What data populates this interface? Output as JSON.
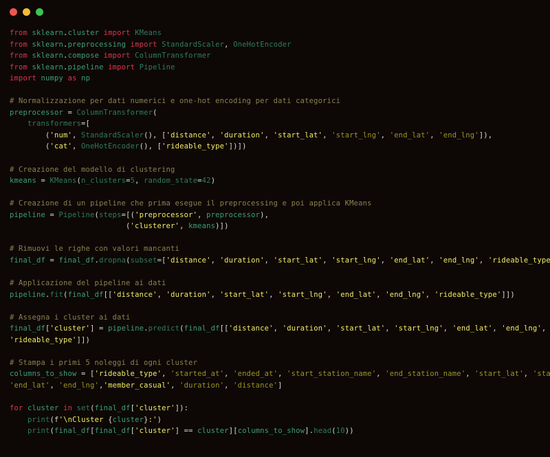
{
  "window": {
    "name": "code-editor-window",
    "background": "#0d0806",
    "traffic_lights": [
      {
        "name": "close-button",
        "color": "#f0564f",
        "label": "close"
      },
      {
        "name": "minimize-button",
        "color": "#f2bb35",
        "label": "minimize"
      },
      {
        "name": "maximize-button",
        "color": "#3ec44f",
        "label": "maximize"
      }
    ]
  },
  "theme": {
    "keyword": "#e0344d",
    "identifier": "#3d9e7a",
    "function": "#2f7a62",
    "string": "#e8e05a",
    "string_dim": "#9a9326",
    "comment": "#8a8050",
    "plain": "#dcdcd0",
    "number": "#2f7a62"
  },
  "code": {
    "language": "python",
    "lines": [
      "from sklearn.cluster import KMeans",
      "from sklearn.preprocessing import StandardScaler, OneHotEncoder",
      "from sklearn.compose import ColumnTransformer",
      "from sklearn.pipeline import Pipeline",
      "import numpy as np",
      "",
      "# Normalizzazione per dati numerici e one-hot encoding per dati categorici",
      "preprocessor = ColumnTransformer(",
      "    transformers=[",
      "        ('num', StandardScaler(), ['distance', 'duration', 'start_lat', 'start_lng', 'end_lat', 'end_lng']),",
      "        ('cat', OneHotEncoder(), ['rideable_type'])])",
      "",
      "# Creazione del modello di clustering",
      "kmeans = KMeans(n_clusters=5, random_state=42)",
      "",
      "# Creazione di un pipeline che prima esegue il preprocessing e poi applica KMeans",
      "pipeline = Pipeline(steps=[('preprocessor', preprocessor),",
      "                          ('clusterer', kmeans)])",
      "",
      "# Rimuovi le righe con valori mancanti",
      "final_df = final_df.dropna(subset=['distance', 'duration', 'start_lat', 'start_lng', 'end_lat', 'end_lng', 'rideable_type'])",
      "",
      "# Applicazione del pipeline ai dati",
      "pipeline.fit(final_df[['distance', 'duration', 'start_lat', 'start_lng', 'end_lat', 'end_lng', 'rideable_type']])",
      "",
      "# Assegna i cluster ai dati",
      "final_df['cluster'] = pipeline.predict(final_df[['distance', 'duration', 'start_lat', 'start_lng', 'end_lat', 'end_lng', 'rideable_type']])",
      "",
      "# Stampa i primi 5 noleggi di ogni cluster",
      "columns_to_show = ['rideable_type', 'started_at', 'ended_at', 'start_station_name', 'end_station_name', 'start_lat', 'start_lng', 'end_lat', 'end_lng','member_casual', 'duration', 'distance']",
      "",
      "for cluster in set(final_df['cluster']):",
      "    print(f'\\nCluster {cluster}:')",
      "    print(final_df[final_df['cluster'] == cluster][columns_to_show].head(10))"
    ],
    "segments": [
      [
        [
          "kw",
          "from"
        ],
        [
          "pl",
          " "
        ],
        [
          "name",
          "sklearn"
        ],
        [
          "pl",
          "."
        ],
        [
          "name",
          "cluster"
        ],
        [
          "pl",
          " "
        ],
        [
          "kw",
          "import"
        ],
        [
          "pl",
          " "
        ],
        [
          "cls",
          "KMeans"
        ]
      ],
      [
        [
          "kw",
          "from"
        ],
        [
          "pl",
          " "
        ],
        [
          "name",
          "sklearn"
        ],
        [
          "pl",
          "."
        ],
        [
          "name",
          "preprocessing"
        ],
        [
          "pl",
          " "
        ],
        [
          "kw",
          "import"
        ],
        [
          "pl",
          " "
        ],
        [
          "cls",
          "StandardScaler"
        ],
        [
          "pl",
          ", "
        ],
        [
          "cls",
          "OneHotEncoder"
        ]
      ],
      [
        [
          "kw",
          "from"
        ],
        [
          "pl",
          " "
        ],
        [
          "name",
          "sklearn"
        ],
        [
          "pl",
          "."
        ],
        [
          "name",
          "compose"
        ],
        [
          "pl",
          " "
        ],
        [
          "kw",
          "import"
        ],
        [
          "pl",
          " "
        ],
        [
          "cls",
          "ColumnTransformer"
        ]
      ],
      [
        [
          "kw",
          "from"
        ],
        [
          "pl",
          " "
        ],
        [
          "name",
          "sklearn"
        ],
        [
          "pl",
          "."
        ],
        [
          "name",
          "pipeline"
        ],
        [
          "pl",
          " "
        ],
        [
          "kw",
          "import"
        ],
        [
          "pl",
          " "
        ],
        [
          "cls",
          "Pipeline"
        ]
      ],
      [
        [
          "kw",
          "import"
        ],
        [
          "pl",
          " "
        ],
        [
          "name",
          "numpy"
        ],
        [
          "pl",
          " "
        ],
        [
          "kw",
          "as"
        ],
        [
          "pl",
          " "
        ],
        [
          "name",
          "np"
        ]
      ],
      [],
      [
        [
          "com",
          "# Normalizzazione per dati numerici e one-hot encoding per dati categorici"
        ]
      ],
      [
        [
          "name",
          "preprocessor"
        ],
        [
          "pl",
          " = "
        ],
        [
          "fn",
          "ColumnTransformer"
        ],
        [
          "pl",
          "("
        ]
      ],
      [
        [
          "pl",
          "    "
        ],
        [
          "param",
          "transformers"
        ],
        [
          "pl",
          "=["
        ]
      ],
      [
        [
          "pl",
          "        ("
        ],
        [
          "bright",
          "'num'"
        ],
        [
          "pl",
          ", "
        ],
        [
          "fn",
          "StandardScaler"
        ],
        [
          "pl",
          "(), ["
        ],
        [
          "bright",
          "'distance'"
        ],
        [
          "pl",
          ", "
        ],
        [
          "bright",
          "'duration'"
        ],
        [
          "pl",
          ", "
        ],
        [
          "bright",
          "'start_lat'"
        ],
        [
          "pl",
          ", "
        ],
        [
          "strd",
          "'start_lng'"
        ],
        [
          "pl",
          ", "
        ],
        [
          "strd",
          "'end_lat'"
        ],
        [
          "pl",
          ", "
        ],
        [
          "strd",
          "'end_lng'"
        ],
        [
          "pl",
          "]),"
        ]
      ],
      [
        [
          "pl",
          "        ("
        ],
        [
          "bright",
          "'cat'"
        ],
        [
          "pl",
          ", "
        ],
        [
          "fn",
          "OneHotEncoder"
        ],
        [
          "pl",
          "(), ["
        ],
        [
          "bright",
          "'rideable_type'"
        ],
        [
          "pl",
          "])])"
        ]
      ],
      [],
      [
        [
          "com",
          "# Creazione del modello di clustering"
        ]
      ],
      [
        [
          "name",
          "kmeans"
        ],
        [
          "pl",
          " = "
        ],
        [
          "fn",
          "KMeans"
        ],
        [
          "pl",
          "("
        ],
        [
          "param",
          "n_clusters"
        ],
        [
          "pl",
          "="
        ],
        [
          "num",
          "5"
        ],
        [
          "pl",
          ", "
        ],
        [
          "param",
          "random_state"
        ],
        [
          "pl",
          "="
        ],
        [
          "num",
          "42"
        ],
        [
          "pl",
          ")"
        ]
      ],
      [],
      [
        [
          "com",
          "# Creazione di un pipeline che prima esegue il preprocessing e poi applica KMeans"
        ]
      ],
      [
        [
          "name",
          "pipeline"
        ],
        [
          "pl",
          " = "
        ],
        [
          "fn",
          "Pipeline"
        ],
        [
          "pl",
          "("
        ],
        [
          "param",
          "steps"
        ],
        [
          "pl",
          "=[("
        ],
        [
          "bright",
          "'preprocessor'"
        ],
        [
          "pl",
          ", "
        ],
        [
          "name",
          "preprocessor"
        ],
        [
          "pl",
          "),"
        ]
      ],
      [
        [
          "pl",
          "                          ("
        ],
        [
          "bright",
          "'clusterer'"
        ],
        [
          "pl",
          ", "
        ],
        [
          "name",
          "kmeans"
        ],
        [
          "pl",
          ")])"
        ]
      ],
      [],
      [
        [
          "com",
          "# Rimuovi le righe con valori mancanti"
        ]
      ],
      [
        [
          "name",
          "final_df"
        ],
        [
          "pl",
          " = "
        ],
        [
          "name",
          "final_df"
        ],
        [
          "pl",
          "."
        ],
        [
          "fn",
          "dropna"
        ],
        [
          "pl",
          "("
        ],
        [
          "param",
          "subset"
        ],
        [
          "pl",
          "=["
        ],
        [
          "bright",
          "'distance'"
        ],
        [
          "pl",
          ", "
        ],
        [
          "bright",
          "'duration'"
        ],
        [
          "pl",
          ", "
        ],
        [
          "bright",
          "'start_lat'"
        ],
        [
          "pl",
          ", "
        ],
        [
          "bright",
          "'start_lng'"
        ],
        [
          "pl",
          ", "
        ],
        [
          "bright",
          "'end_lat'"
        ],
        [
          "pl",
          ", "
        ],
        [
          "bright",
          "'end_lng'"
        ],
        [
          "pl",
          ", "
        ],
        [
          "bright",
          "'rideable_type'"
        ],
        [
          "pl",
          "])"
        ]
      ],
      [],
      [
        [
          "com",
          "# Applicazione del pipeline ai dati"
        ]
      ],
      [
        [
          "name",
          "pipeline"
        ],
        [
          "pl",
          "."
        ],
        [
          "fn",
          "fit"
        ],
        [
          "pl",
          "("
        ],
        [
          "name",
          "final_df"
        ],
        [
          "pl",
          "[["
        ],
        [
          "bright",
          "'distance'"
        ],
        [
          "pl",
          ", "
        ],
        [
          "bright",
          "'duration'"
        ],
        [
          "pl",
          ", "
        ],
        [
          "bright",
          "'start_lat'"
        ],
        [
          "pl",
          ", "
        ],
        [
          "bright",
          "'start_lng'"
        ],
        [
          "pl",
          ", "
        ],
        [
          "bright",
          "'end_lat'"
        ],
        [
          "pl",
          ", "
        ],
        [
          "bright",
          "'end_lng'"
        ],
        [
          "pl",
          ", "
        ],
        [
          "bright",
          "'rideable_type'"
        ],
        [
          "pl",
          "]])"
        ]
      ],
      [],
      [
        [
          "com",
          "# Assegna i cluster ai dati"
        ]
      ],
      [
        [
          "name",
          "final_df"
        ],
        [
          "pl",
          "["
        ],
        [
          "bright",
          "'cluster'"
        ],
        [
          "pl",
          "] = "
        ],
        [
          "name",
          "pipeline"
        ],
        [
          "pl",
          "."
        ],
        [
          "fn",
          "predict"
        ],
        [
          "pl",
          "("
        ],
        [
          "name",
          "final_df"
        ],
        [
          "pl",
          "[["
        ],
        [
          "bright",
          "'distance'"
        ],
        [
          "pl",
          ", "
        ],
        [
          "bright",
          "'duration'"
        ],
        [
          "pl",
          ", "
        ],
        [
          "bright",
          "'start_lat'"
        ],
        [
          "pl",
          ", "
        ],
        [
          "bright",
          "'start_lng'"
        ],
        [
          "pl",
          ", "
        ],
        [
          "bright",
          "'end_lat'"
        ],
        [
          "pl",
          ", "
        ],
        [
          "bright",
          "'end_lng'"
        ],
        [
          "pl",
          ","
        ]
      ],
      [
        [
          "bright",
          "'rideable_type'"
        ],
        [
          "pl",
          "]])"
        ]
      ],
      [],
      [
        [
          "com",
          "# Stampa i primi 5 noleggi di ogni cluster"
        ]
      ],
      [
        [
          "name",
          "columns_to_show"
        ],
        [
          "pl",
          " = ["
        ],
        [
          "bright",
          "'rideable_type'"
        ],
        [
          "pl",
          ", "
        ],
        [
          "strd",
          "'started_at'"
        ],
        [
          "pl",
          ", "
        ],
        [
          "strd",
          "'ended_at'"
        ],
        [
          "pl",
          ", "
        ],
        [
          "strd",
          "'start_station_name'"
        ],
        [
          "pl",
          ", "
        ],
        [
          "strd",
          "'end_station_name'"
        ],
        [
          "pl",
          ", "
        ],
        [
          "strd",
          "'start_lat'"
        ],
        [
          "pl",
          ", "
        ],
        [
          "strd",
          "'start_lng'"
        ],
        [
          "pl",
          ","
        ]
      ],
      [
        [
          "strd",
          "'end_lat'"
        ],
        [
          "pl",
          ", "
        ],
        [
          "strd",
          "'end_lng'"
        ],
        [
          "pl",
          ","
        ],
        [
          "bright",
          "'member_casual'"
        ],
        [
          "pl",
          ", "
        ],
        [
          "strd",
          "'duration'"
        ],
        [
          "pl",
          ", "
        ],
        [
          "strd",
          "'distance'"
        ],
        [
          "pl",
          "]"
        ]
      ],
      [],
      [
        [
          "kw",
          "for"
        ],
        [
          "pl",
          " "
        ],
        [
          "name",
          "cluster"
        ],
        [
          "pl",
          " "
        ],
        [
          "kw",
          "in"
        ],
        [
          "pl",
          " "
        ],
        [
          "fn",
          "set"
        ],
        [
          "pl",
          "("
        ],
        [
          "name",
          "final_df"
        ],
        [
          "pl",
          "["
        ],
        [
          "bright",
          "'cluster'"
        ],
        [
          "pl",
          "]):"
        ]
      ],
      [
        [
          "pl",
          "    "
        ],
        [
          "fn",
          "print"
        ],
        [
          "pl",
          "("
        ],
        [
          "pl",
          "f"
        ],
        [
          "bright",
          "'\\nCluster "
        ],
        [
          "pl",
          "{"
        ],
        [
          "name",
          "cluster"
        ],
        [
          "pl",
          "}"
        ],
        [
          "bright",
          ":'"
        ],
        [
          "pl",
          ")"
        ]
      ],
      [
        [
          "pl",
          "    "
        ],
        [
          "fn",
          "print"
        ],
        [
          "pl",
          "("
        ],
        [
          "name",
          "final_df"
        ],
        [
          "pl",
          "["
        ],
        [
          "name",
          "final_df"
        ],
        [
          "pl",
          "["
        ],
        [
          "bright",
          "'cluster'"
        ],
        [
          "pl",
          "] "
        ],
        [
          "op",
          "=="
        ],
        [
          "pl",
          " "
        ],
        [
          "name",
          "cluster"
        ],
        [
          "pl",
          "]["
        ],
        [
          "name",
          "columns_to_show"
        ],
        [
          "pl",
          "]."
        ],
        [
          "fn",
          "head"
        ],
        [
          "pl",
          "("
        ],
        [
          "num",
          "10"
        ],
        [
          "pl",
          "))"
        ]
      ]
    ]
  }
}
